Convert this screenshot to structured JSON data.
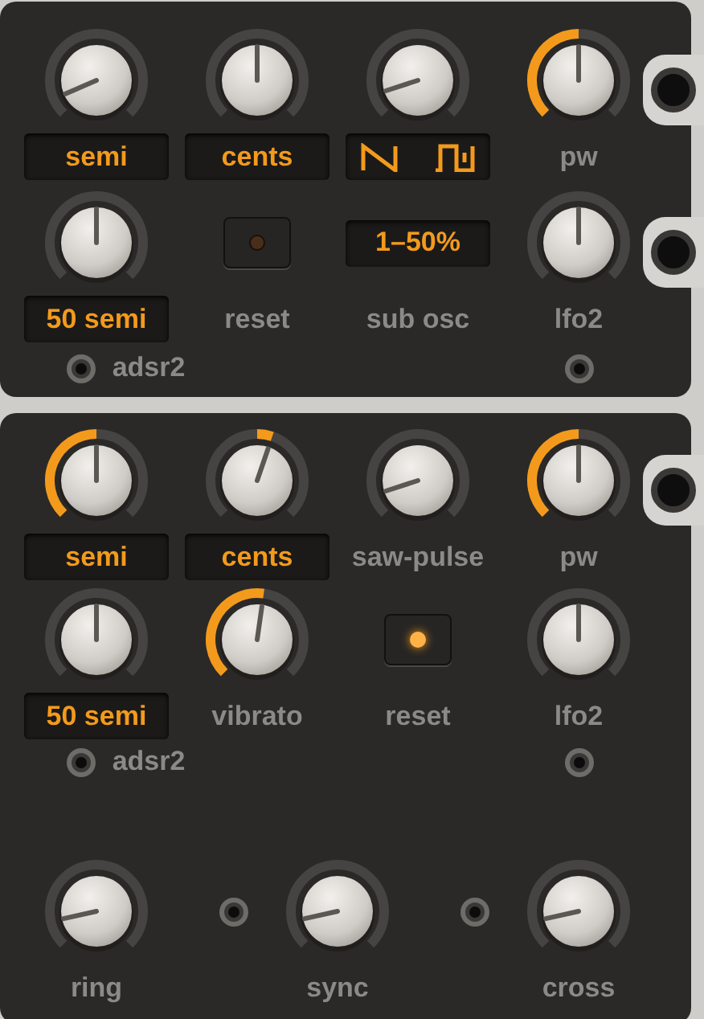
{
  "panels": [
    {
      "rows": [
        {
          "kind": "grid",
          "jack": true,
          "items": [
            {
              "kind": "knob",
              "caption": {
                "kind": "display",
                "text": "semi"
              }
            },
            {
              "kind": "knob",
              "caption": {
                "kind": "display",
                "text": "cents"
              }
            },
            {
              "kind": "knob",
              "caption": {
                "kind": "waveforms"
              }
            },
            {
              "kind": "knob",
              "caption": {
                "kind": "label",
                "text": "pw"
              }
            }
          ]
        },
        {
          "kind": "grid",
          "jack": true,
          "items": [
            {
              "kind": "knob",
              "caption": {
                "kind": "display",
                "text": "50 semi"
              }
            },
            {
              "kind": "button",
              "lit": false,
              "caption": {
                "kind": "label",
                "text": "reset"
              }
            },
            {
              "kind": "display",
              "text": "1–50%",
              "caption": {
                "kind": "label",
                "text": "sub osc"
              }
            },
            {
              "kind": "knob",
              "caption": {
                "kind": "label",
                "text": "lfo2"
              }
            }
          ]
        },
        {
          "kind": "sockets",
          "items": [
            {
              "kind": "socket",
              "label": "adsr2"
            },
            {
              "kind": "empty"
            },
            {
              "kind": "empty"
            },
            {
              "kind": "socket"
            }
          ]
        }
      ]
    },
    {
      "rows": [
        {
          "kind": "grid",
          "jack": true,
          "items": [
            {
              "kind": "knob",
              "caption": {
                "kind": "display",
                "text": "semi"
              }
            },
            {
              "kind": "knob",
              "caption": {
                "kind": "display",
                "text": "cents"
              }
            },
            {
              "kind": "knob",
              "caption": {
                "kind": "label",
                "text": "saw-pulse"
              }
            },
            {
              "kind": "knob",
              "caption": {
                "kind": "label",
                "text": "pw"
              }
            }
          ]
        },
        {
          "kind": "grid",
          "jack": false,
          "items": [
            {
              "kind": "knob",
              "caption": {
                "kind": "display",
                "text": "50 semi"
              }
            },
            {
              "kind": "knob",
              "caption": {
                "kind": "label",
                "text": "vibrato"
              }
            },
            {
              "kind": "button",
              "lit": true,
              "caption": {
                "kind": "label",
                "text": "reset"
              }
            },
            {
              "kind": "knob",
              "caption": {
                "kind": "label",
                "text": "lfo2"
              }
            }
          ]
        },
        {
          "kind": "sockets",
          "items": [
            {
              "kind": "socket",
              "label": "adsr2"
            },
            {
              "kind": "empty"
            },
            {
              "kind": "empty"
            },
            {
              "kind": "socket"
            }
          ]
        },
        {
          "kind": "spread",
          "items": [
            {
              "kind": "knob",
              "caption": {
                "kind": "label",
                "text": "ring"
              }
            },
            {
              "kind": "socket"
            },
            {
              "kind": "knob",
              "caption": {
                "kind": "label",
                "text": "sync"
              }
            },
            {
              "kind": "socket"
            },
            {
              "kind": "knob",
              "caption": {
                "kind": "label",
                "text": "cross"
              }
            }
          ]
        }
      ]
    }
  ]
}
